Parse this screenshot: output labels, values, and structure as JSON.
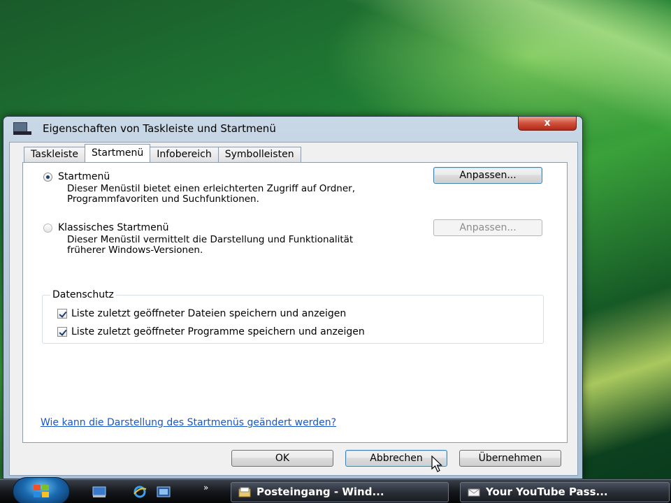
{
  "window": {
    "title": "Eigenschaften von Taskleiste und Startmenü",
    "close_glyph": "x"
  },
  "tabs": [
    {
      "label": "Taskleiste",
      "active": false
    },
    {
      "label": "Startmenü",
      "active": true
    },
    {
      "label": "Infobereich",
      "active": false
    },
    {
      "label": "Symbolleisten",
      "active": false
    }
  ],
  "startmenu": {
    "option_label": "Startmenü",
    "option_checked": true,
    "description": "Dieser Menüstil bietet einen erleichterten Zugriff auf Ordner, Programmfavoriten und Suchfunktionen.",
    "customize_label": "Anpassen..."
  },
  "classic": {
    "option_label": "Klassisches Startmenü",
    "option_checked": false,
    "description": "Dieser Menüstil vermittelt die Darstellung und Funktionalität früherer Windows-Versionen.",
    "customize_label": "Anpassen...",
    "customize_enabled": false
  },
  "privacy": {
    "group_title": "Datenschutz",
    "items": [
      {
        "label": "Liste zuletzt geöffneter Dateien speichern und anzeigen",
        "checked": true
      },
      {
        "label": "Liste zuletzt geöffneter Programme speichern und anzeigen",
        "checked": true
      }
    ]
  },
  "help_link": "Wie kann die Darstellung des Startmenüs geändert werden?",
  "buttons": {
    "ok": "OK",
    "cancel": "Abbrechen",
    "apply": "Übernehmen"
  },
  "taskbar": {
    "overflow_glyph": "»",
    "tasks": [
      {
        "label": "Posteingang - Wind...",
        "icon": "mail-folder-icon"
      },
      {
        "label": "Your YouTube Pass...",
        "icon": "envelope-icon"
      }
    ]
  }
}
